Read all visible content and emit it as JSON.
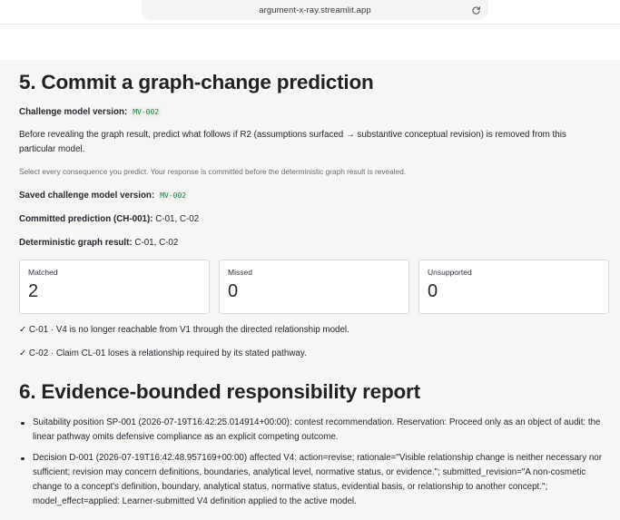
{
  "browser": {
    "url": "argument-x-ray.streamlit.app",
    "reload_icon": "reload-icon"
  },
  "section5": {
    "title": "5. Commit a graph-change prediction",
    "challenge_label": "Challenge model version:",
    "challenge_code": "MV-002",
    "intro": "Before revealing the graph result, predict what follows if R2 (assumptions surfaced → substantive conceptual revision) is removed from this particular model.",
    "caption": "Select every consequence you predict. Your response is committed before the deterministic graph result is revealed.",
    "saved_label": "Saved challenge model version:",
    "saved_code": "MV-002",
    "committed_label": "Committed prediction (CH-001):",
    "committed_value": " C-01, C-02",
    "graph_label": "Deterministic graph result:",
    "graph_value": " C-01, C-02",
    "metrics": [
      {
        "label": "Matched",
        "value": "2"
      },
      {
        "label": "Missed",
        "value": "0"
      },
      {
        "label": "Unsupported",
        "value": "0"
      }
    ],
    "checks": [
      "✓ C-01 · V4 is no longer reachable from V1 through the directed relationship model.",
      "✓ C-02 · Claim CL-01 loses a relationship required by its stated pathway."
    ]
  },
  "section6": {
    "title": "6. Evidence-bounded responsibility report",
    "items": [
      "Suitability position SP-001 (2026-07-19T16:42:25.014914+00:00): contest recommendation. Reservation: Proceed only as an object of audit: the linear pathway omits defensive compliance as an explicit competing outcome.",
      "Decision D-001 (2026-07-19T16:42:48.957169+00:00) affected V4: action=revise; rationale=\"Visible relationship change is neither necessary nor sufficient; revision may concern definitions, boundaries, analytical level, normative status, or evidence.\"; submitted_revision=\"A non-cosmetic change to a concept's definition, boundary, analytical status, normative status, evidential basis, or relationship to another concept.\"; model_effect=applied: Learner-submitted V4 definition applied to the active model."
    ]
  }
}
